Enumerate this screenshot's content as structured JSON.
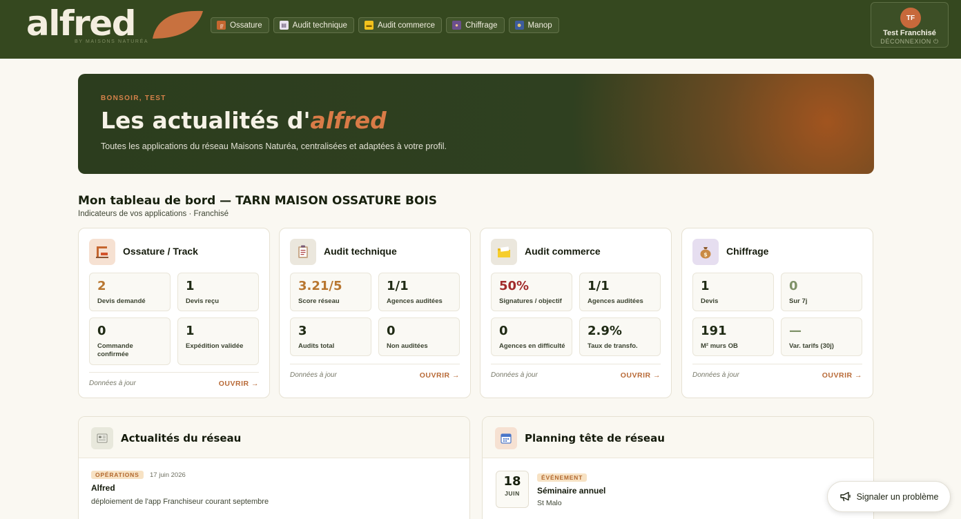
{
  "brand": {
    "name": "alfred",
    "tagline": "BY MAISONS NATURÉA"
  },
  "nav": [
    {
      "label": "Ossature",
      "icon": "frame-icon"
    },
    {
      "label": "Audit technique",
      "icon": "clipboard-icon"
    },
    {
      "label": "Audit commerce",
      "icon": "folder-icon"
    },
    {
      "label": "Chiffrage",
      "icon": "money-bag-icon"
    },
    {
      "label": "Manop",
      "icon": "people-icon"
    }
  ],
  "user": {
    "initials": "TF",
    "name": "Test Franchisé",
    "logout": "DÉCONNEXION ⏻"
  },
  "hero": {
    "greeting": "BONSOIR, TEST",
    "title_prefix": "Les actualités d'",
    "title_brand": "alfred",
    "description": "Toutes les applications du réseau Maisons Naturéa, centralisées et adaptées à votre profil."
  },
  "dashboard": {
    "title": "Mon tableau de bord — TARN MAISON OSSATURE BOIS",
    "subtitle": "Indicateurs de vos applications · Franchisé"
  },
  "cards": [
    {
      "title": "Ossature / Track",
      "icon": "frame-icon",
      "metrics": [
        {
          "value": "2",
          "label": "Devis demandé"
        },
        {
          "value": "1",
          "label": "Devis reçu"
        },
        {
          "value": "0",
          "label": "Commande confirmée"
        },
        {
          "value": "1",
          "label": "Expédition validée"
        }
      ],
      "footer": "Données à jour",
      "open": "OUVRIR →"
    },
    {
      "title": "Audit technique",
      "icon": "clipboard-icon",
      "metrics": [
        {
          "value": "3.21/5",
          "label": "Score réseau"
        },
        {
          "value": "1/1",
          "label": "Agences auditées"
        },
        {
          "value": "3",
          "label": "Audits total"
        },
        {
          "value": "0",
          "label": "Non auditées"
        }
      ],
      "footer": "Données à jour",
      "open": "OUVRIR →"
    },
    {
      "title": "Audit commerce",
      "icon": "folder-icon",
      "metrics": [
        {
          "value": "50%",
          "label": "Signatures / objectif"
        },
        {
          "value": "1/1",
          "label": "Agences auditées"
        },
        {
          "value": "0",
          "label": "Agences en difficulté"
        },
        {
          "value": "2.9%",
          "label": "Taux de transfo."
        }
      ],
      "footer": "Données à jour",
      "open": "OUVRIR →"
    },
    {
      "title": "Chiffrage",
      "icon": "money-bag-icon",
      "metrics": [
        {
          "value": "1",
          "label": "Devis"
        },
        {
          "value": "0",
          "label": "Sur 7j"
        },
        {
          "value": "191",
          "label": "M² murs OB"
        },
        {
          "value": "—",
          "label": "Var. tarifs (30j)"
        }
      ],
      "footer": "Données à jour",
      "open": "OUVRIR →"
    }
  ],
  "news": {
    "title": "Actualités du réseau",
    "item": {
      "badge": "OPÉRATIONS",
      "date": "17 juin 2026",
      "title": "Alfred",
      "text": "déploiement de l'app Franchiseur courant septembre"
    }
  },
  "planning": {
    "title": "Planning tête de réseau",
    "event": {
      "day": "18",
      "month": "JUIN",
      "badge": "ÉVÉNEMENT",
      "title": "Séminaire annuel",
      "place": "St Malo"
    }
  },
  "report": {
    "label": "Signaler un problème"
  },
  "colors": {
    "topbar": "#35481f",
    "accent": "#c7693b",
    "open_link": "#b86a37",
    "value_orange": "#b87630",
    "value_red": "#a22c2c",
    "value_muted": "#7f9268"
  }
}
